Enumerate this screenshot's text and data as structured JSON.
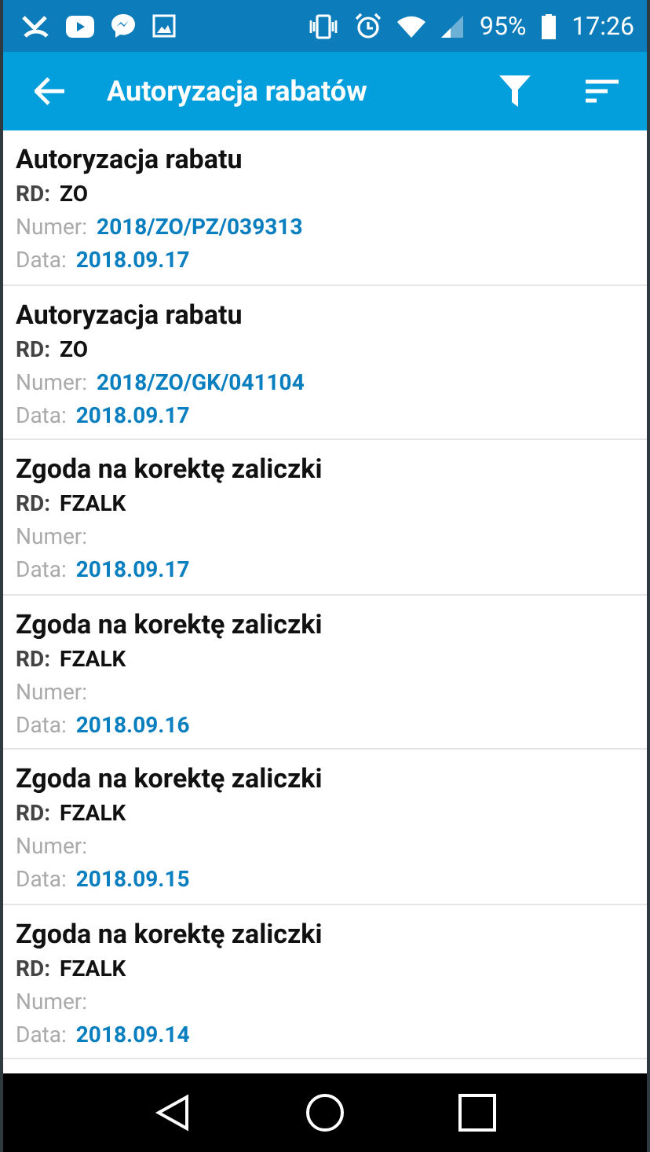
{
  "status_bar": {
    "battery": "95%",
    "time": "17:26"
  },
  "app_bar": {
    "title": "Autoryzacja rabatów"
  },
  "items": [
    {
      "title": "Autoryzacja rabatu",
      "rd_label": "RD:",
      "rd": "ZO",
      "number_label": "Numer:",
      "number": "2018/ZO/PZ/039313",
      "date_label": "Data:",
      "date": "2018.09.17"
    },
    {
      "title": "Autoryzacja rabatu",
      "rd_label": "RD:",
      "rd": "ZO",
      "number_label": "Numer:",
      "number": "2018/ZO/GK/041104",
      "date_label": "Data:",
      "date": "2018.09.17"
    },
    {
      "title": "Zgoda na korektę zaliczki",
      "rd_label": "RD:",
      "rd": "FZALK",
      "number_label": "Numer:",
      "date_label": "Data:",
      "date": "2018.09.17"
    },
    {
      "title": "Zgoda na korektę zaliczki",
      "rd_label": "RD:",
      "rd": "FZALK",
      "number_label": "Numer:",
      "date_label": "Data:",
      "date": "2018.09.16"
    },
    {
      "title": "Zgoda na korektę zaliczki",
      "rd_label": "RD:",
      "rd": "FZALK",
      "number_label": "Numer:",
      "date_label": "Data:",
      "date": "2018.09.15"
    },
    {
      "title": "Zgoda na korektę zaliczki",
      "rd_label": "RD:",
      "rd": "FZALK",
      "number_label": "Numer:",
      "date_label": "Data:",
      "date": "2018.09.14"
    }
  ]
}
